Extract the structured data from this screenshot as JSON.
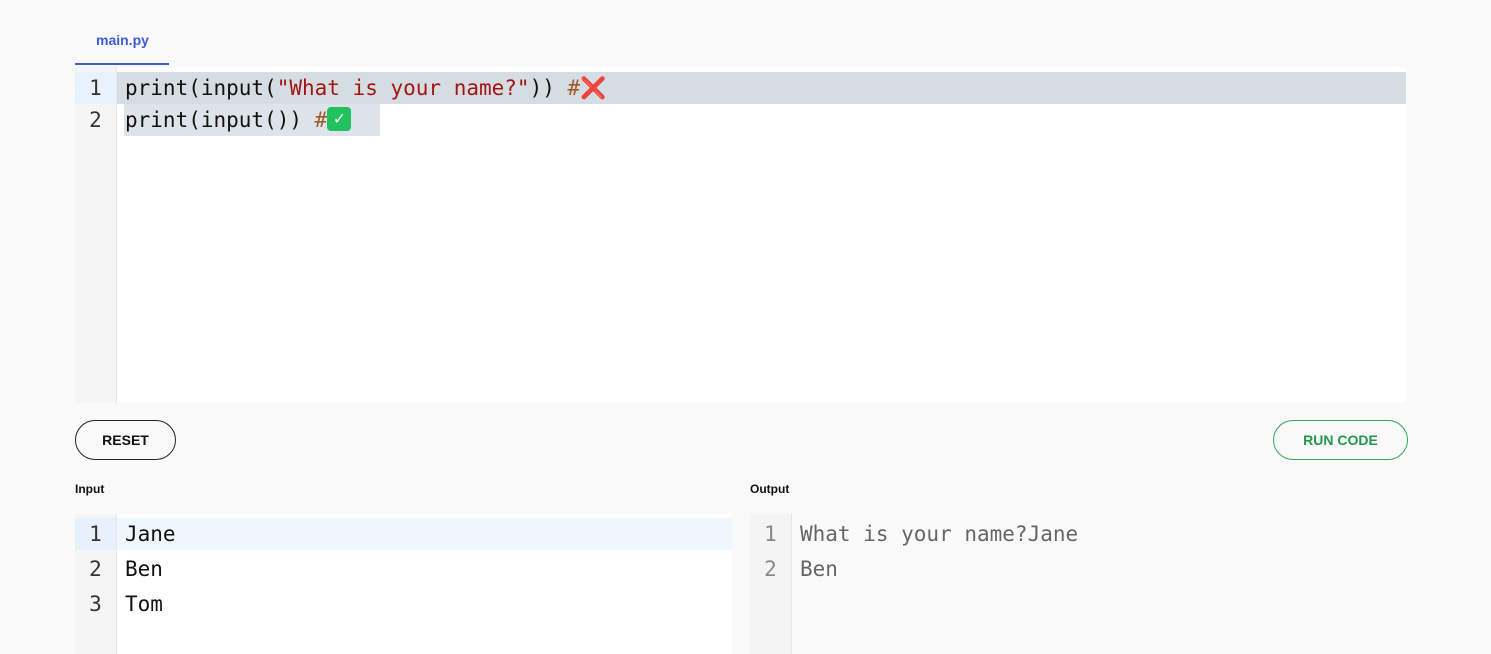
{
  "tabs": [
    {
      "label": "main.py"
    }
  ],
  "editor": {
    "lines": [
      {
        "number": "1",
        "code": "print(",
        "call": "input(",
        "string": "\"What is your name?\"",
        "close": ")) ",
        "comment": "#",
        "marker_icon": "cross-mark-icon",
        "marker": "❌"
      },
      {
        "number": "2",
        "code": "print(input()) ",
        "comment": "#",
        "marker_icon": "check-mark-icon",
        "marker": "✓"
      }
    ]
  },
  "buttons": {
    "reset": "RESET",
    "run": "RUN CODE"
  },
  "input": {
    "label": "Input",
    "lines": [
      {
        "number": "1",
        "text": "Jane"
      },
      {
        "number": "2",
        "text": "Ben"
      },
      {
        "number": "3",
        "text": "Tom"
      }
    ]
  },
  "output": {
    "label": "Output",
    "lines": [
      {
        "number": "1",
        "text": "What is your name?Jane"
      },
      {
        "number": "2",
        "text": "Ben"
      }
    ]
  },
  "colors": {
    "accent": "#3b5bdb",
    "run": "#23974d",
    "string": "#a31515",
    "comment": "#a05a2c",
    "cross": "#f0334f",
    "check": "#21c25e"
  }
}
